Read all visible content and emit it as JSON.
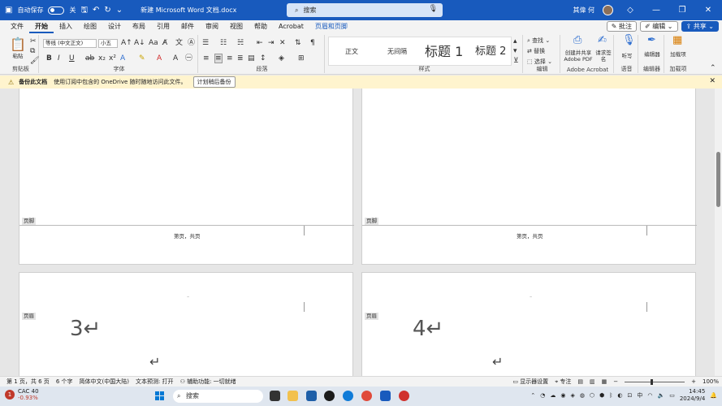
{
  "titlebar": {
    "autosave_label": "自动保存",
    "autosave_state": "关",
    "doc_title": "新建 Microsoft Word 文档.docx",
    "search_placeholder": "搜索",
    "user_name": "其偉 何"
  },
  "tabs": [
    "文件",
    "开始",
    "插入",
    "绘图",
    "设计",
    "布局",
    "引用",
    "邮件",
    "审阅",
    "视图",
    "帮助",
    "Acrobat",
    "页眉和页脚"
  ],
  "tabs_right": {
    "comments": "批注",
    "editing": "编辑",
    "share": "共享"
  },
  "ribbon": {
    "clipboard": {
      "paste": "粘贴",
      "label": "剪贴板"
    },
    "font": {
      "font_name": "等线 (中文正文)",
      "font_size": "小五",
      "label": "字体"
    },
    "paragraph": {
      "label": "段落"
    },
    "styles": {
      "items": [
        "正文",
        "无间隔",
        "标题 1",
        "标题 2"
      ],
      "label": "样式"
    },
    "editing": {
      "find": "查找",
      "replace": "替换",
      "select": "选择",
      "label": "编辑"
    },
    "acrobat": {
      "create_share": "创建并共享 Adobe PDF",
      "request_sign": "请求签名",
      "label": "Adobe Acrobat"
    },
    "voice": {
      "dictate": "听写",
      "label": "语音"
    },
    "editor": {
      "editor": "编辑器",
      "label": "编辑器"
    },
    "addins": {
      "addins": "加载项",
      "label": "加载项"
    }
  },
  "notice": {
    "title": "备份此文档",
    "message": "使用订阅中包含的 OneDrive 随时随地访问此文件。",
    "button": "计划稍后备份"
  },
  "pages": {
    "footer_tag": "页脚",
    "header_tag": "页眉",
    "footer_text": "第页，共页",
    "page3_number": "3↵",
    "page4_number": "4↵",
    "para_mark": "↵"
  },
  "statusbar": {
    "page": "第 1 页，共 6 页",
    "words": "6 个字",
    "language": "简体中文(中国大陆)",
    "text_predictions": "文本预测: 打开",
    "accessibility": "辅助功能: 一切就绪",
    "display_settings": "显示器设置",
    "focus": "专注",
    "zoom": "100%"
  },
  "taskbar": {
    "stock_name": "CAC 40",
    "stock_change": "-0.93%",
    "stock_badge": "1",
    "search": "搜索",
    "time": "14:45",
    "date": "2024/9/4"
  }
}
